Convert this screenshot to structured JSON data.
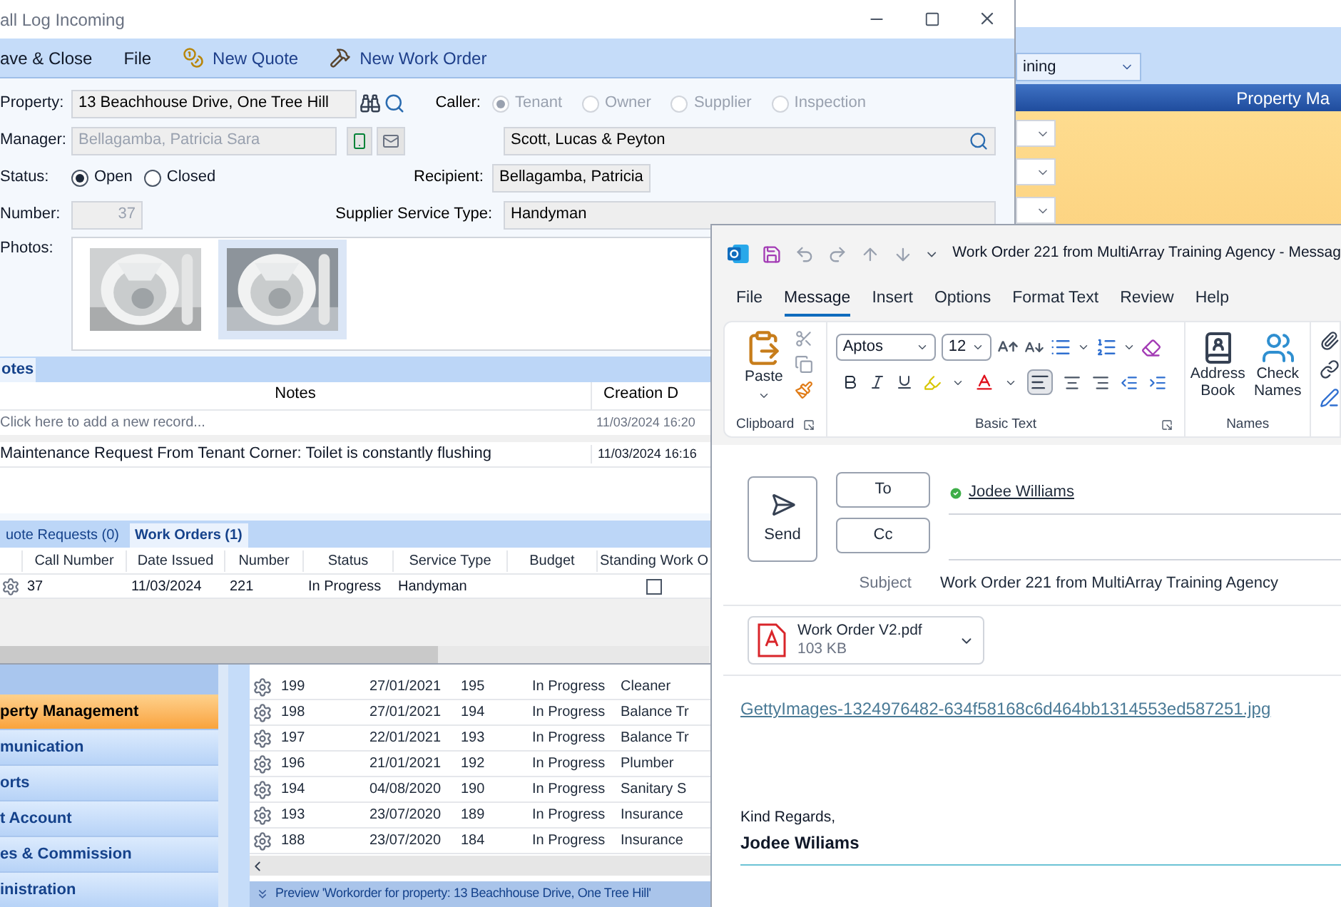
{
  "background_app": {
    "location_dropdown": {
      "value": "ining"
    },
    "header_title": "Property Ma",
    "sidebar": {
      "items": [
        {
          "label": "perty Management",
          "selected": true
        },
        {
          "label": "munication",
          "selected": false
        },
        {
          "label": "orts",
          "selected": false
        },
        {
          "label": "t Account",
          "selected": false
        },
        {
          "label": "es & Commission",
          "selected": false
        },
        {
          "label": "inistration",
          "selected": false
        }
      ]
    },
    "work_orders_grid": {
      "rows": [
        {
          "call_number": "199",
          "date": "27/01/2021",
          "number": "195",
          "status": "In Progress",
          "service_type": "Cleaner"
        },
        {
          "call_number": "198",
          "date": "27/01/2021",
          "number": "194",
          "status": "In Progress",
          "service_type": "Balance Tr"
        },
        {
          "call_number": "197",
          "date": "22/01/2021",
          "number": "193",
          "status": "In Progress",
          "service_type": "Balance Tr"
        },
        {
          "call_number": "196",
          "date": "21/01/2021",
          "number": "192",
          "status": "In Progress",
          "service_type": "Plumber"
        },
        {
          "call_number": "194",
          "date": "04/08/2020",
          "number": "190",
          "status": "In Progress",
          "service_type": "Sanitary S"
        },
        {
          "call_number": "193",
          "date": "23/07/2020",
          "number": "189",
          "status": "In Progress",
          "service_type": "Insurance"
        },
        {
          "call_number": "188",
          "date": "23/07/2020",
          "number": "184",
          "status": "In Progress",
          "service_type": "Insurance"
        }
      ]
    },
    "preview_bar": "Preview 'Workorder for property: 13 Beachhouse Drive, One Tree Hill'"
  },
  "call_log_window": {
    "title": "all Log Incoming",
    "toolbar": [
      {
        "kind": "text",
        "label": "ave & Close"
      },
      {
        "kind": "text",
        "label": "File"
      },
      {
        "kind": "quote",
        "label": "New Quote"
      },
      {
        "kind": "work_order",
        "label": "New Work Order"
      }
    ],
    "form": {
      "property": {
        "label": "Property:",
        "value": "13 Beachhouse Drive, One Tree Hill"
      },
      "manager": {
        "label": "Manager:",
        "value": "Bellagamba, Patricia Sara"
      },
      "status": {
        "label": "Status:",
        "options": [
          {
            "label": "Open",
            "selected": true
          },
          {
            "label": "Closed",
            "selected": false
          }
        ]
      },
      "number": {
        "label": "Number:",
        "value": "37"
      },
      "photos": {
        "label": "Photos:",
        "items": [
          {
            "kind": "picture",
            "selected": false
          },
          {
            "kind": "picture",
            "selected": true
          }
        ]
      },
      "caller": {
        "label": "Caller:",
        "disabled": true,
        "options": [
          {
            "label": "Tenant",
            "selected": true
          },
          {
            "label": "Owner",
            "selected": false
          },
          {
            "label": "Supplier",
            "selected": false
          },
          {
            "label": "Inspection",
            "selected": false
          }
        ]
      },
      "caller_name": {
        "value": "Scott, Lucas & Peyton"
      },
      "recipient": {
        "label": "Recipient:",
        "value": "Bellagamba, Patricia"
      },
      "supplier_service_type": {
        "label": "Supplier Service Type:",
        "value": "Handyman"
      }
    },
    "notes_tabs": [
      {
        "label": "otes",
        "selected": true
      }
    ],
    "notes_grid": {
      "columns": [
        "Notes",
        "Creation D"
      ],
      "new_row": {
        "placeholder": "Click here to add a new record...",
        "date": "11/03/2024 16:20"
      },
      "rows": [
        {
          "note": "Maintenance Request From Tenant Corner: Toilet is constantly flushing",
          "date": "11/03/2024 16:16"
        }
      ]
    },
    "work_tabs": [
      {
        "label": "uote Requests (0)",
        "selected": false
      },
      {
        "label": "Work Orders (1)",
        "selected": true
      }
    ],
    "work_grid": {
      "columns": [
        "Call Number",
        "Date Issued",
        "Number",
        "Status",
        "Service Type",
        "Budget",
        "Standing Work O"
      ],
      "rows": [
        {
          "call_number": "37",
          "date_issued": "11/03/2024",
          "number": "221",
          "status": "In Progress",
          "service_type": "Handyman",
          "standing_work_order": false
        }
      ]
    }
  },
  "outlook_window": {
    "title": "Work Order 221 from MultiArray Training Agency - Messag",
    "menu_tabs": [
      {
        "label": "File",
        "selected": false
      },
      {
        "label": "Message",
        "selected": true
      },
      {
        "label": "Insert",
        "selected": false
      },
      {
        "label": "Options",
        "selected": false
      },
      {
        "label": "Format Text",
        "selected": false
      },
      {
        "label": "Review",
        "selected": false
      },
      {
        "label": "Help",
        "selected": false
      }
    ],
    "ribbon": {
      "paste": "Paste",
      "clipboard_group": "Clipboard",
      "font": "Aptos",
      "font_size": "12",
      "basic_text_group": "Basic Text",
      "address_book": "Address Book",
      "check_names": "Check Names",
      "names_group": "Names"
    },
    "send": "Send",
    "to": "To",
    "cc": "Cc",
    "to_recipients": [
      "Jodee Williams"
    ],
    "subject_label": "Subject",
    "subject": "Work Order 221 from MultiArray Training Agency",
    "attachment": {
      "name": "Work Order V2.pdf",
      "size": "103 KB"
    },
    "body": {
      "link": "GettyImages-1324976482-634f58168c6d464bb1314553ed587251.jpg",
      "closing": "Kind Regards,",
      "signature": "Jodee Wiliams"
    }
  }
}
